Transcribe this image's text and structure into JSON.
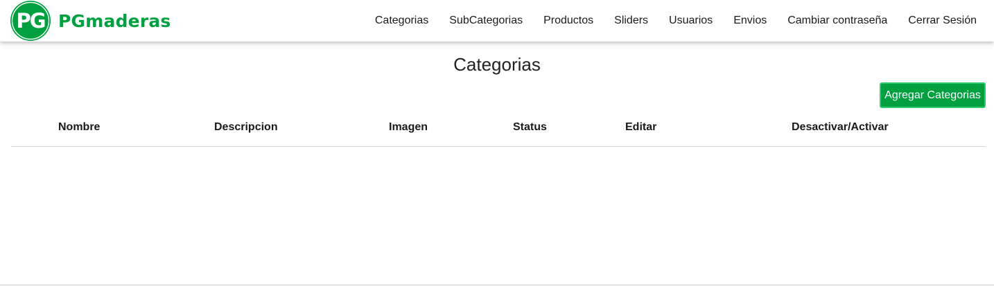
{
  "brand": {
    "logo_letters": "PG",
    "name": "PGmaderas",
    "color": "#00a040"
  },
  "nav": {
    "items": [
      {
        "label": "Categorias"
      },
      {
        "label": "SubCategorias"
      },
      {
        "label": "Productos"
      },
      {
        "label": "Sliders"
      },
      {
        "label": "Usuarios"
      },
      {
        "label": "Envios"
      },
      {
        "label": "Cambiar contraseña"
      },
      {
        "label": "Cerrar Sesión"
      }
    ]
  },
  "main": {
    "title": "Categorias",
    "add_button_label": "Agregar Categorias",
    "table": {
      "columns": [
        "Nombre",
        "Descripcion",
        "Imagen",
        "Status",
        "Editar",
        "Desactivar/Activar"
      ],
      "rows": []
    }
  },
  "colors": {
    "accent": "#00a040",
    "button_border": "#2ecc71"
  }
}
